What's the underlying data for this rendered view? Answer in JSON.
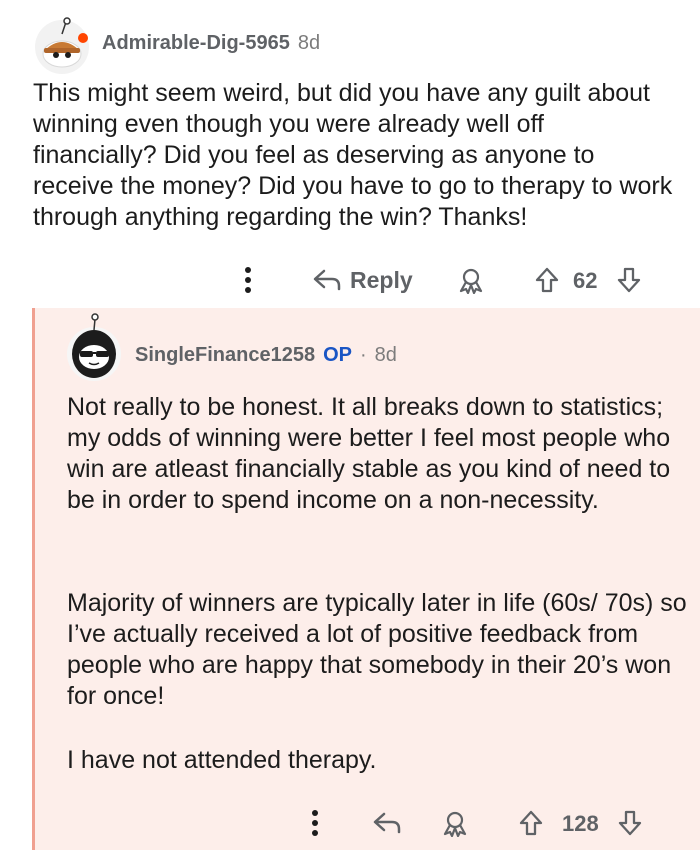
{
  "comment": {
    "username": "Admirable-Dig-5965",
    "age": "8d",
    "body": "This might seem weird, but did you have any guilt about winning even though you were already well off financially? Did you feel as deserving as anyone to receive the money? Did you have to go to therapy to work through anything regarding the win? Thanks!",
    "actions": {
      "reply_label": "Reply",
      "upvote_count": "62"
    }
  },
  "reply": {
    "username": "SingleFinance1258",
    "op_badge": "OP",
    "separator": "·",
    "age": "8d",
    "paragraphs": [
      "Not really to be honest. It all breaks down to statistics; my odds of winning were better I feel most people who win are atleast financially stable as you kind of need to be in order to spend income on a non-necessity.",
      "Majority of winners are typically later in life (60s/ 70s) so I’ve actually received a lot of positive feedback from people who are happy that somebody in their 20’s won for once!",
      "I have not attended therapy."
    ],
    "actions": {
      "upvote_count": "128"
    }
  },
  "colors": {
    "reply_background": "#fdeeea",
    "thread_line": "#f0a090",
    "op_badge": "#1a55c4",
    "meta_text": "#5f6266"
  },
  "icons": [
    "more-options-icon",
    "reply-arrow-icon",
    "award-icon",
    "upvote-arrow-icon",
    "downvote-arrow-icon"
  ]
}
